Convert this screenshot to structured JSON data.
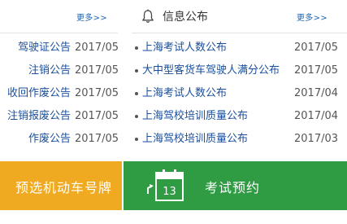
{
  "left_panel": {
    "more_label": "更多>>",
    "items": [
      {
        "title": "驾驶证公告",
        "date": "2017/05"
      },
      {
        "title": "注销公告",
        "date": "2017/05"
      },
      {
        "title": "收回作废公告",
        "date": "2017/05"
      },
      {
        "title": "注销报废公告",
        "date": "2017/05"
      },
      {
        "title": "作废公告",
        "date": "2017/05"
      }
    ]
  },
  "right_panel": {
    "title": "信息公布",
    "more_label": "更多>>",
    "icon": "bell-icon",
    "items": [
      {
        "title": "上海考试人数公布",
        "date": "2017/05"
      },
      {
        "title": "大中型客货车驾驶人满分公布",
        "date": "2017/05"
      },
      {
        "title": "上海考试人数公布",
        "date": "2017/04"
      },
      {
        "title": "上海驾校培训质量公布",
        "date": "2017/04"
      },
      {
        "title": "上海驾校培训质量公布",
        "date": "2017/03"
      }
    ]
  },
  "banners": {
    "plate": {
      "label": "预选机动车号牌",
      "color": "#efaa21"
    },
    "exam": {
      "label": "考试预约",
      "icon": "calendar-icon",
      "calendar_day": "13",
      "color": "#2f9b43"
    }
  }
}
